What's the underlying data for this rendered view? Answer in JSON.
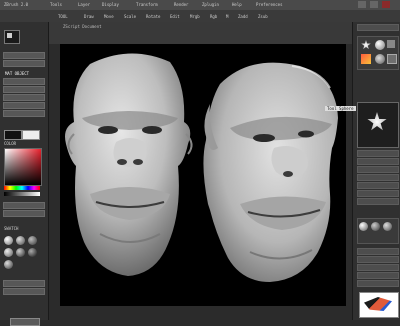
{
  "app": {
    "menu": [
      "ZBrush 2.0",
      "Tools",
      "Layer",
      "Display",
      "Transform",
      "Render",
      "Zplugin",
      "Help",
      "Preferences"
    ],
    "document_tab": "ZScript Document",
    "toolbar_items": [
      "TOOL",
      "Draw",
      "Move",
      "Scale",
      "Rotate",
      "Edit",
      "Mrgb",
      "Rgb",
      "M",
      "Zadd",
      "Zsub"
    ]
  },
  "left": {
    "section_label": "MATERIAL",
    "material_label": "MAT OBJECT",
    "color_label": "COLOR",
    "swatch_label": "SWATCH"
  },
  "right": {
    "tooltip": "Tool Sphere"
  },
  "colors": {
    "panel": "#303030",
    "canvas": "#000000",
    "accent": "#e05a3a",
    "highlight": "#7a4a1e"
  }
}
